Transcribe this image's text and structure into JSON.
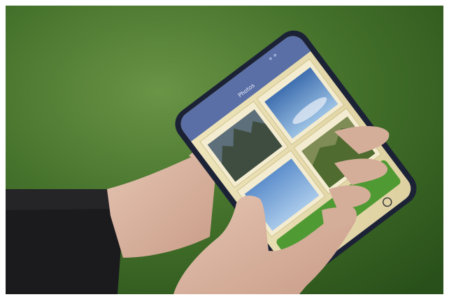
{
  "screen": {
    "title": "Photos"
  },
  "colors": {
    "grass_light": "#5f8a3e",
    "grass_dark": "#2b5219",
    "phone_body": "#1c2236",
    "app_header": "#5a6fa6",
    "app_background": "#e8ddb0",
    "action_button": "#4f9a33",
    "skin": "#d9b7a4",
    "sleeve": "#1b1b1d"
  },
  "icons": [
    "app-icon",
    "app-icon",
    "app-icon",
    "settings-icon"
  ]
}
